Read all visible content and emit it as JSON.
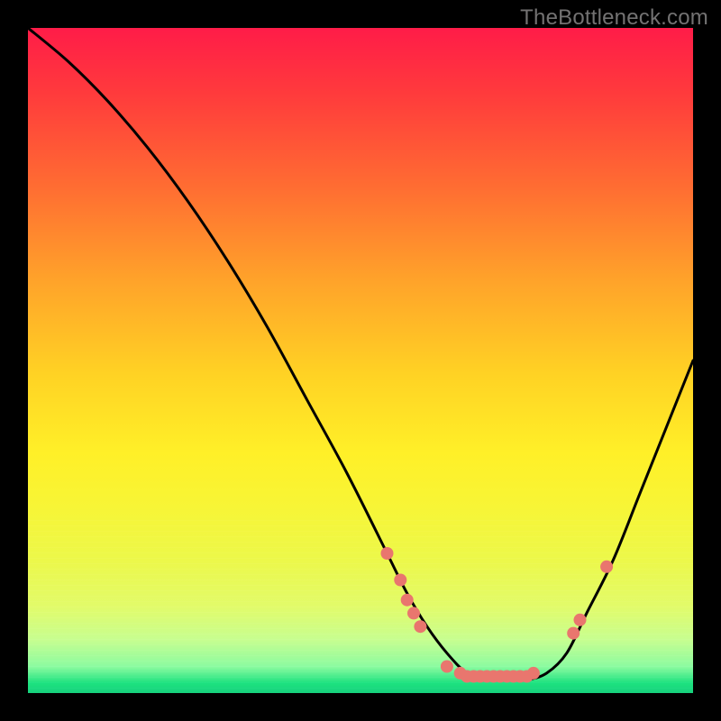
{
  "watermark": "TheBottleneck.com",
  "colors": {
    "background": "#000000",
    "curve_stroke": "#000000",
    "dot_fill": "#e9766e",
    "gradient_top": "#ff1c48",
    "gradient_mid": "#fff028",
    "gradient_bottom": "#17d27d"
  },
  "chart_data": {
    "type": "line",
    "title": "",
    "xlabel": "",
    "ylabel": "",
    "xlim": [
      0,
      100
    ],
    "ylim": [
      0,
      100
    ],
    "grid": false,
    "legend": false,
    "note": "No axes or tick labels are rendered. Values are estimated from pixel positions; y represents relative height (0 = bottom, 100 = top).",
    "series": [
      {
        "name": "curve",
        "x": [
          0,
          6,
          12,
          18,
          24,
          30,
          36,
          42,
          48,
          54,
          57,
          60,
          63,
          66,
          69,
          72,
          75,
          78,
          81,
          84,
          88,
          92,
          96,
          100
        ],
        "y": [
          100,
          95,
          89,
          82,
          74,
          65,
          55,
          44,
          33,
          21,
          15,
          10,
          6,
          3,
          2,
          2,
          2,
          3,
          6,
          12,
          20,
          30,
          40,
          50
        ]
      }
    ],
    "marker_points": {
      "comment": "salmon dots lying on the curve near the valley",
      "points": [
        {
          "x": 54,
          "y": 21
        },
        {
          "x": 56,
          "y": 17
        },
        {
          "x": 57,
          "y": 14
        },
        {
          "x": 58,
          "y": 12
        },
        {
          "x": 59,
          "y": 10
        },
        {
          "x": 63,
          "y": 4
        },
        {
          "x": 65,
          "y": 3
        },
        {
          "x": 66,
          "y": 2.5
        },
        {
          "x": 67,
          "y": 2.5
        },
        {
          "x": 68,
          "y": 2.5
        },
        {
          "x": 69,
          "y": 2.5
        },
        {
          "x": 70,
          "y": 2.5
        },
        {
          "x": 71,
          "y": 2.5
        },
        {
          "x": 72,
          "y": 2.5
        },
        {
          "x": 73,
          "y": 2.5
        },
        {
          "x": 74,
          "y": 2.5
        },
        {
          "x": 75,
          "y": 2.5
        },
        {
          "x": 76,
          "y": 3
        },
        {
          "x": 82,
          "y": 9
        },
        {
          "x": 83,
          "y": 11
        },
        {
          "x": 87,
          "y": 19
        }
      ]
    }
  }
}
